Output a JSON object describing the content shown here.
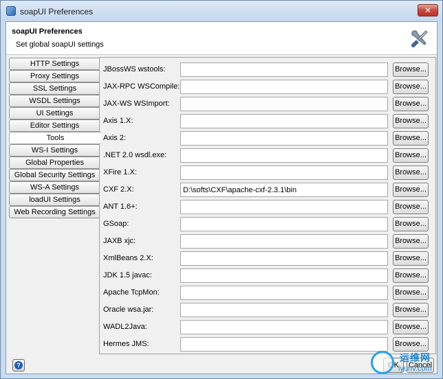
{
  "window": {
    "title": "soapUI Preferences",
    "close_label": "✕"
  },
  "header": {
    "title": "soapUI Preferences",
    "subtitle": "Set global soapUI settings"
  },
  "tabs": [
    {
      "label": "HTTP Settings",
      "active": false
    },
    {
      "label": "Proxy Settings",
      "active": false
    },
    {
      "label": "SSL Settings",
      "active": false
    },
    {
      "label": "WSDL Settings",
      "active": false
    },
    {
      "label": "UI Settings",
      "active": false
    },
    {
      "label": "Editor Settings",
      "active": false
    },
    {
      "label": "Tools",
      "active": true
    },
    {
      "label": "WS-I Settings",
      "active": false
    },
    {
      "label": "Global Properties",
      "active": false
    },
    {
      "label": "Global Security Settings",
      "active": false
    },
    {
      "label": "WS-A Settings",
      "active": false
    },
    {
      "label": "loadUI Settings",
      "active": false
    },
    {
      "label": "Web Recording Settings",
      "active": false
    }
  ],
  "browse_label": "Browse...",
  "tools": [
    {
      "label": "JBossWS wstools:",
      "value": ""
    },
    {
      "label": "JAX-RPC WSCompile:",
      "value": ""
    },
    {
      "label": "JAX-WS WSImport:",
      "value": ""
    },
    {
      "label": "Axis 1.X:",
      "value": ""
    },
    {
      "label": "Axis 2:",
      "value": ""
    },
    {
      "label": ".NET 2.0 wsdl.exe:",
      "value": ""
    },
    {
      "label": "XFire 1.X:",
      "value": ""
    },
    {
      "label": "CXF 2.X:",
      "value": "D:\\softs\\CXF\\apache-cxf-2.3.1\\bin"
    },
    {
      "label": "ANT 1.6+:",
      "value": ""
    },
    {
      "label": "GSoap:",
      "value": ""
    },
    {
      "label": "JAXB xjc:",
      "value": ""
    },
    {
      "label": "XmlBeans 2.X:",
      "value": ""
    },
    {
      "label": "JDK 1.5 javac:",
      "value": ""
    },
    {
      "label": "Apache TcpMon:",
      "value": ""
    },
    {
      "label": "Oracle wsa.jar:",
      "value": ""
    },
    {
      "label": "WADL2Java:",
      "value": ""
    },
    {
      "label": "Hermes JMS:",
      "value": ""
    }
  ],
  "footer": {
    "help_label": "?",
    "ok_label": "OK",
    "cancel_label": "Cancel"
  },
  "watermark": {
    "line1": "运维网",
    "line2": "iyunv.com"
  }
}
